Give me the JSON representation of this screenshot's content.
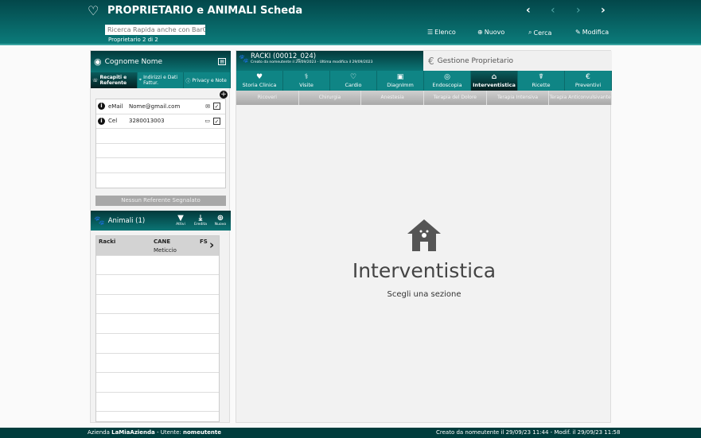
{
  "header": {
    "title": "PROPRIETARIO e ANIMALI Scheda",
    "search_placeholder": "Ricerca Rapida anche con BarCode",
    "record_count": "Proprietario 2 di 2",
    "toolbar": [
      {
        "label": "Elenco",
        "icon": "list-icon"
      },
      {
        "label": "Nuovo",
        "icon": "plus-circle-icon"
      },
      {
        "label": "Cerca",
        "icon": "search-icon"
      },
      {
        "label": "Modifica",
        "icon": "pencil-icon"
      }
    ]
  },
  "owner": {
    "name": "Cognome Nome",
    "tabs": [
      "Recapiti e Referente",
      "Indirizzi e Dati Fattur.",
      "Privacy e Note"
    ],
    "contacts": [
      {
        "type": "eMail",
        "value": "Nome@gmail.com"
      },
      {
        "type": "Cel",
        "value": "3280013003"
      }
    ],
    "no_referent": "Nessun Referente Segnalato"
  },
  "animals": {
    "title": "Animali (1)",
    "buttons": [
      "Attivi",
      "Eredita",
      "Nuovo"
    ],
    "rows": [
      {
        "name": "Racki",
        "species": "CANE",
        "sex": "FS",
        "breed": "Meticcio"
      }
    ]
  },
  "pet": {
    "title": "RACKI (00012_024)",
    "subtitle": "Creato da nomeutente il 29/09/2023 - Ultima modifica il 29/09/2023",
    "manage": "Gestione Proprietario",
    "tabs": [
      "Storia Clinica",
      "Visite",
      "Cardio",
      "DiagnImm",
      "Endoscopia",
      "Interventistica",
      "Ricette",
      "Preventivi"
    ],
    "subtabs": [
      "Ricoveri",
      "Chirurgia",
      "Anestesia",
      "Terapia del Dolore",
      "Terapia Intensiva",
      "Terapia Anticonvulsivante"
    ],
    "section_title": "Interventistica",
    "section_hint": "Scegli una sezione"
  },
  "footer": {
    "company_label": "Azienda",
    "company": "LaMiaAzienda",
    "user_label": "- Utente:",
    "user": "nomeutente",
    "audit": "Creato da nomeutente il 29/09/23 11:44 - Modif.  il 29/09/23 11:58"
  }
}
